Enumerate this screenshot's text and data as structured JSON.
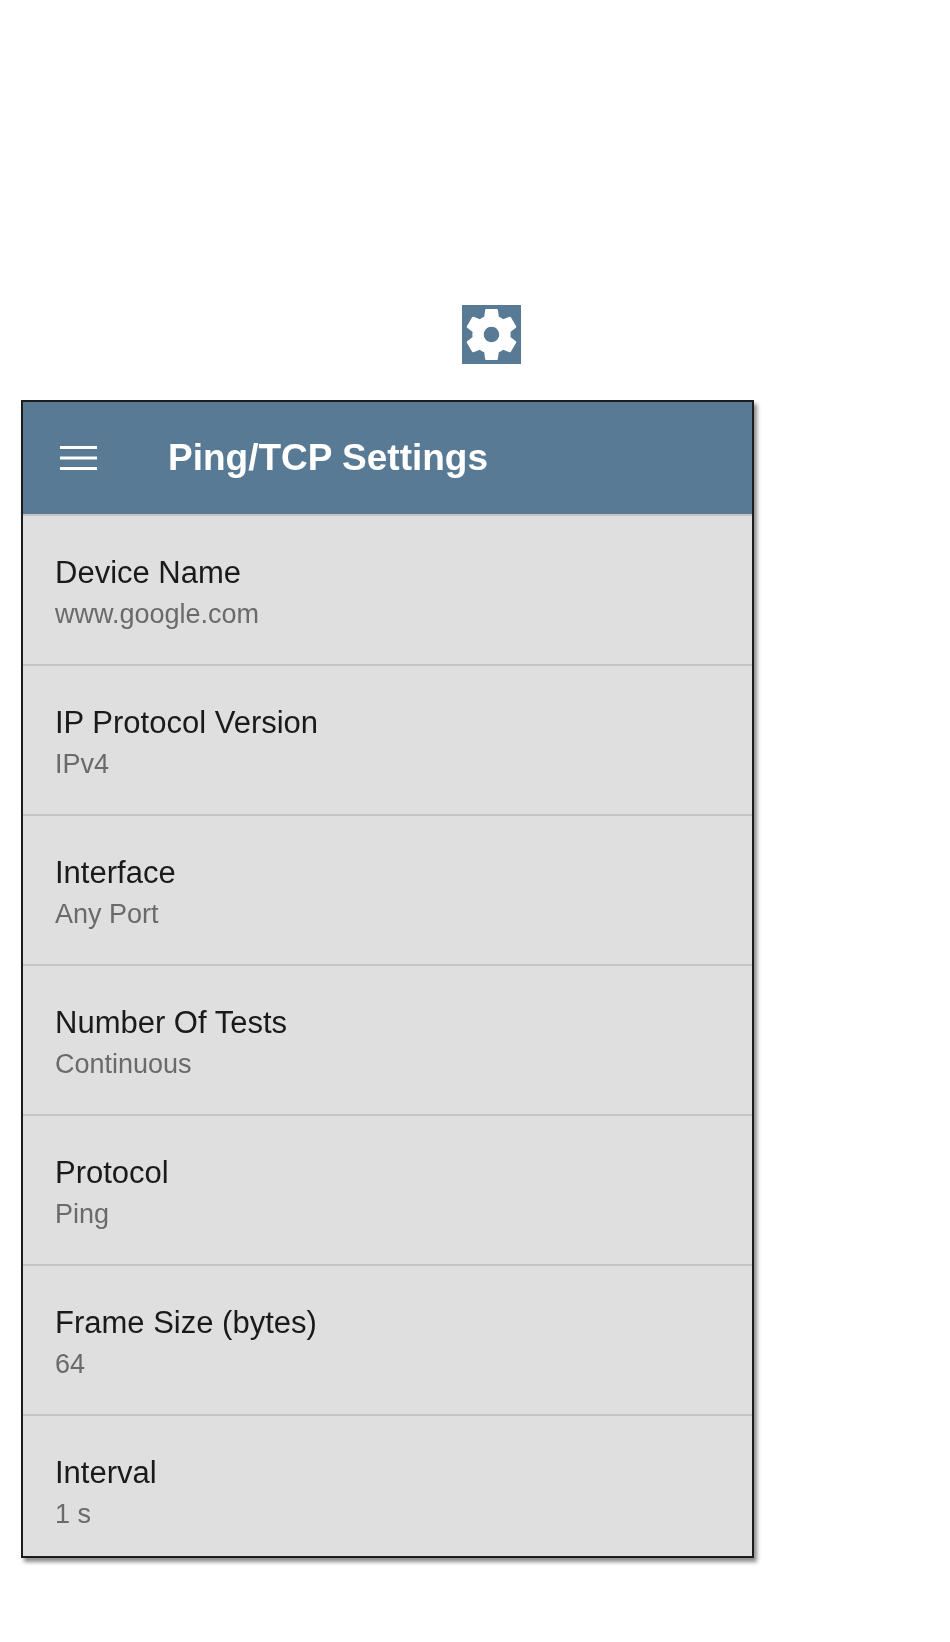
{
  "app_bar": {
    "title": "Ping/TCP Settings"
  },
  "settings": [
    {
      "label": "Device Name",
      "value": "www.google.com"
    },
    {
      "label": "IP Protocol Version",
      "value": "IPv4"
    },
    {
      "label": "Interface",
      "value": "Any Port"
    },
    {
      "label": "Number Of Tests",
      "value": "Continuous"
    },
    {
      "label": "Protocol",
      "value": "Ping"
    },
    {
      "label": "Frame Size (bytes)",
      "value": "64"
    },
    {
      "label": "Interval",
      "value": "1 s"
    }
  ]
}
